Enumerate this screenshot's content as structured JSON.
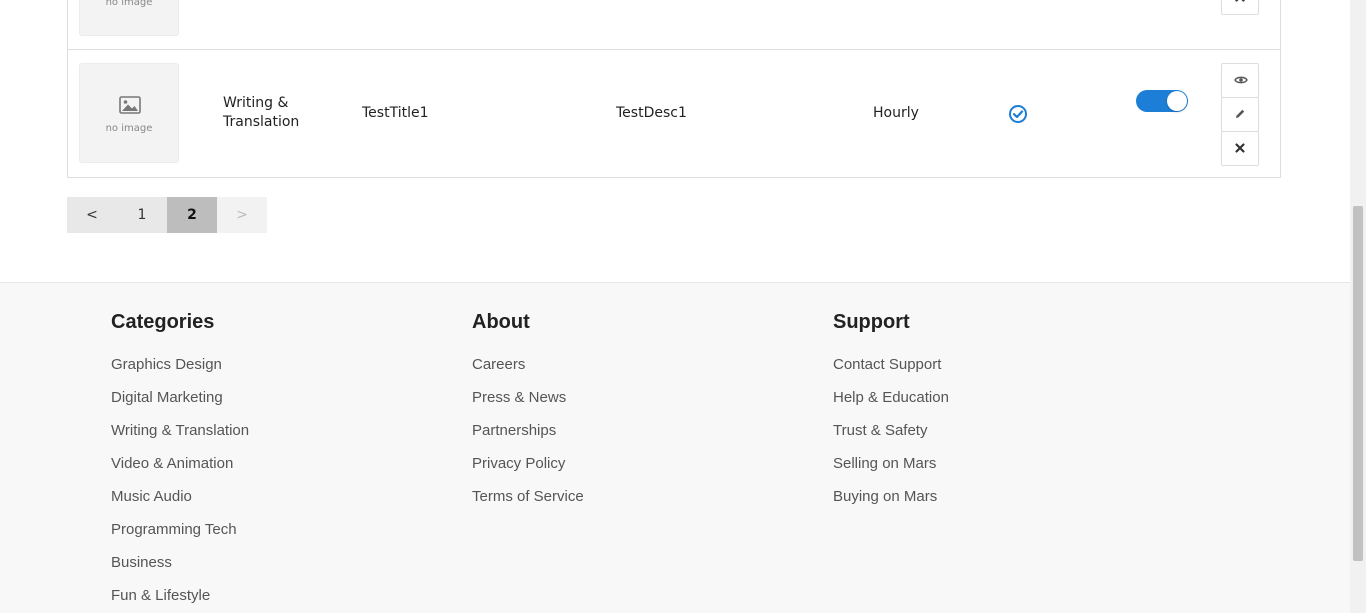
{
  "table": {
    "prev_row": {
      "image_caption": "no image"
    },
    "row": {
      "image_caption": "no image",
      "category": "Writing & Translation",
      "title": "TestTitle1",
      "description": "TestDesc1",
      "type": "Hourly",
      "active": true
    }
  },
  "pagination": {
    "prev": "<",
    "pages": [
      "1",
      "2"
    ],
    "current": "2",
    "next": ">"
  },
  "footer": {
    "categories": {
      "heading": "Categories",
      "links": [
        "Graphics Design",
        "Digital Marketing",
        "Writing & Translation",
        "Video & Animation",
        "Music Audio",
        "Programming Tech",
        "Business",
        "Fun & Lifestyle"
      ]
    },
    "about": {
      "heading": "About",
      "links": [
        "Careers",
        "Press & News",
        "Partnerships",
        "Privacy Policy",
        "Terms of Service"
      ]
    },
    "support": {
      "heading": "Support",
      "links": [
        "Contact Support",
        "Help & Education",
        "Trust & Safety",
        "Selling on Mars",
        "Buying on Mars"
      ]
    }
  },
  "colors": {
    "accent": "#1c7ed6",
    "footer_bg": "#f8f8f8"
  },
  "icons": [
    "image-icon",
    "check-circle-icon",
    "eye-icon",
    "pencil-icon",
    "close-icon"
  ]
}
